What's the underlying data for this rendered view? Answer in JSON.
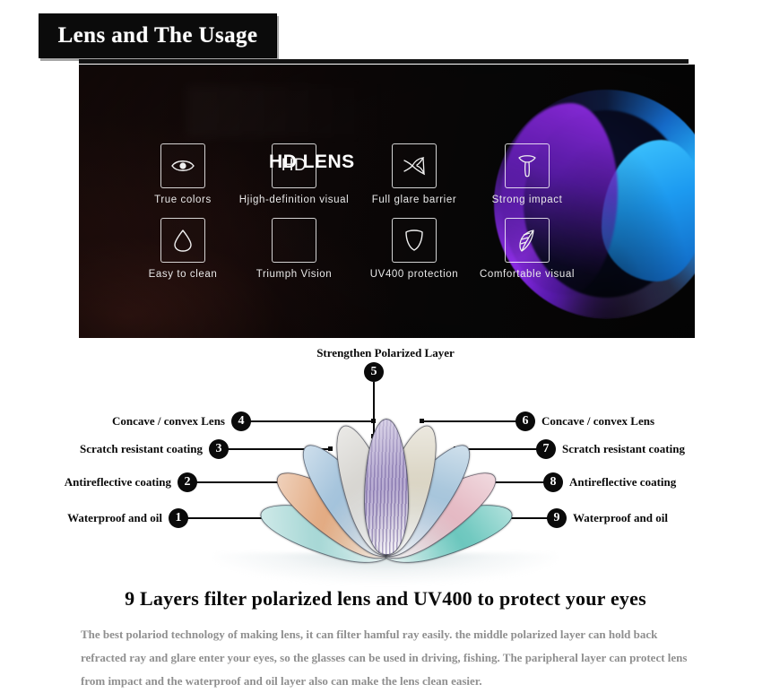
{
  "header": {
    "title": "Lens and The Usage"
  },
  "hero": {
    "title": "HD LENS",
    "features": [
      {
        "icon": "eye-icon",
        "label": "True  colors"
      },
      {
        "icon": "hd-text-icon",
        "label": "Hjigh-definition  visual",
        "text": "HD"
      },
      {
        "icon": "glare-rays-icon",
        "label": "Full  glare  barrier"
      },
      {
        "icon": "hammer-icon",
        "label": "Strong  impact"
      },
      {
        "icon": "water-drop-icon",
        "label": "Easy  to  clean"
      },
      {
        "icon": "blank-icon",
        "label": "Triumph  Vision"
      },
      {
        "icon": "shield-icon",
        "label": "UV400  protection"
      },
      {
        "icon": "feather-icon",
        "label": "Comfortable  visual"
      }
    ]
  },
  "diagram": {
    "top_label": "Strengthen Polarized Layer",
    "top_badge": "5",
    "left_callouts": [
      {
        "number": "4",
        "label": "Concave / convex Lens"
      },
      {
        "number": "3",
        "label": "Scratch resistant coating"
      },
      {
        "number": "2",
        "label": "Antireflective coating"
      },
      {
        "number": "1",
        "label": "Waterproof and oil"
      }
    ],
    "right_callouts": [
      {
        "number": "6",
        "label": "Concave / convex Lens"
      },
      {
        "number": "7",
        "label": "Scratch resistant coating"
      },
      {
        "number": "8",
        "label": "Antireflective coating"
      },
      {
        "number": "9",
        "label": "Waterproof and oil"
      }
    ],
    "petal_colors": [
      "#9fd4d2",
      "#e0a377",
      "#9bbdd8",
      "#d4d2cd",
      "#a89ac8",
      "#d8d2c0",
      "#9fc0d8",
      "#e2b3be",
      "#5fc2b8"
    ]
  },
  "bottom": {
    "heading": "9 Layers filter polarized lens  and UV400 to protect your eyes",
    "paragraph": "The best polariod technology of making lens, it can filter hamful ray easily. the middle polarized layer can hold back refracted ray and glare enter your eyes, so the glasses can be used in driving, fishing. The paripheral layer can protect lens from impact and the waterproof and oil layer also can make the lens clean easier."
  }
}
